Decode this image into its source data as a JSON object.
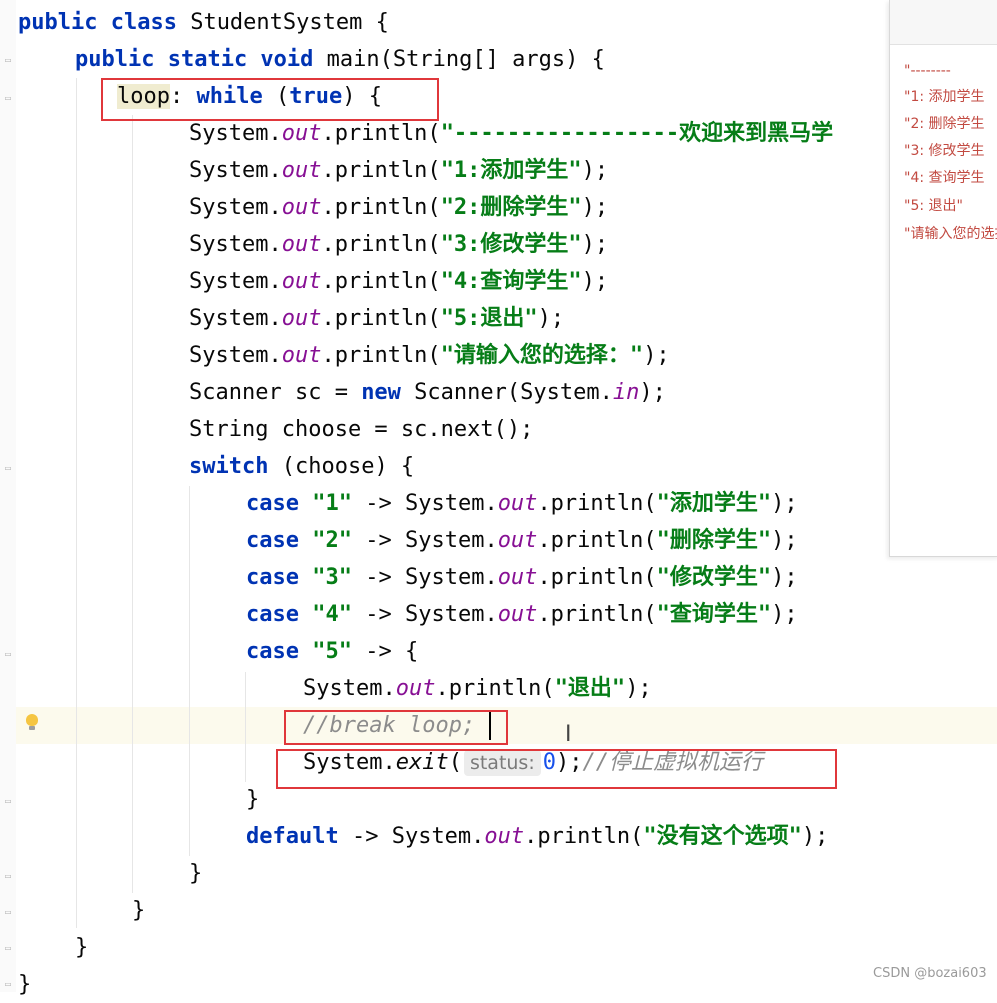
{
  "code": {
    "l1": {
      "kw": "public class",
      "rest": " StudentSystem {"
    },
    "l2": {
      "kw": "public static void",
      "rest": " main(String[] args) {"
    },
    "l3": {
      "label": "loop",
      "sep": ": ",
      "kw1": "while",
      "open": " (",
      "kw2": "true",
      "close": ") {"
    },
    "println_prefix": "System.",
    "out": "out",
    "println_call": ".println(",
    "println_end": ");",
    "s_welcome": "\"-----------------欢迎来到黑马学",
    "s_1": "\"1:添加学生\"",
    "s_2": "\"2:删除学生\"",
    "s_3": "\"3:修改学生\"",
    "s_4": "\"4:查询学生\"",
    "s_5": "\"5:退出\"",
    "s_prompt": "\"请输入您的选择：\"",
    "l11": {
      "a": "Scanner sc = ",
      "kw": "new",
      "b": " Scanner(System.",
      "fld": "in",
      "c": ");"
    },
    "l12": "String choose = sc.next();",
    "l13": {
      "kw": "switch",
      "rest": " (choose) {"
    },
    "case_kw": "case",
    "arrow": " -> ",
    "c1": "\"1\"",
    "c2": "\"2\"",
    "c3": "\"3\"",
    "c4": "\"4\"",
    "c5": "\"5\"",
    "p_add": "\"添加学生\"",
    "p_del": "\"删除学生\"",
    "p_mod": "\"修改学生\"",
    "p_qry": "\"查询学生\"",
    "case5_open": " -> {",
    "p_exit": "\"退出\"",
    "comment_break": "//break loop;",
    "exit_prefix": "System.",
    "exit_method": "exit",
    "exit_open": "(",
    "hint_label": "status:",
    "exit_arg": "0",
    "exit_close": ");",
    "comment_exit": "//停止虚拟机运行",
    "brace_close": "}",
    "default_kw": "default",
    "p_none": "\"没有这个选项\""
  },
  "popup": {
    "lines": [
      "\"--------",
      "\"1: 添加学生",
      "\"2: 删除学生",
      "\"3: 修改学生",
      "\"4: 查询学生",
      "\"5: 退出\"",
      "\"请输入您的选择"
    ]
  },
  "watermark": "CSDN @bozai603",
  "colors": {
    "keyword": "#0033b3",
    "string": "#067d17",
    "field": "#871094",
    "comment": "#8c8c8c",
    "highlight_box": "#e0373b"
  }
}
